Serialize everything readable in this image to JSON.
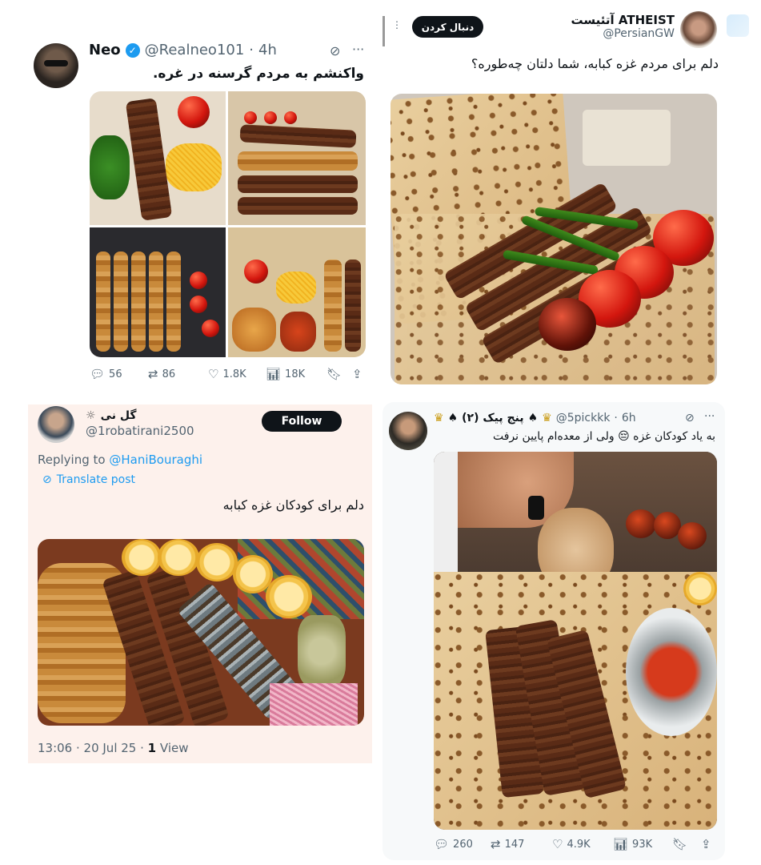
{
  "posts": {
    "neo": {
      "name": "Neo",
      "handle": "@Realneo101",
      "time": "4h",
      "text": "واکنشم به مردم گرسنه در غره.",
      "metrics": {
        "replies": "56",
        "reposts": "86",
        "likes": "1.8K",
        "views": "18K"
      }
    },
    "atheist": {
      "name": "ATHEIST آتئیست",
      "handle": "@PersianGW",
      "follow_label": "دنبال کردن",
      "text": "دلم برای مردم غزه کبابه، شما دلتان چه‌طوره؟"
    },
    "gol": {
      "name": "گل نی",
      "handle": "@1robatirani2500",
      "follow_label": "Follow",
      "replying_prefix": "Replying to",
      "replying_handle": "@HaniBouraghi",
      "translate_label": "Translate post",
      "text": "دلم برای کودکان غزه کبابه",
      "footer_time": "13:06 · 20 Jul 25 ·",
      "footer_views_count": "1",
      "footer_views_label": "View"
    },
    "panjpick": {
      "name": "پنج پیک (۲)",
      "handle": "@5pickkk",
      "time": "6h",
      "text": "به یاد کودکان غزه 😔 ولی از معده‌ام پایین نرفت",
      "metrics": {
        "replies": "260",
        "reposts": "147",
        "likes": "4.9K",
        "views": "93K"
      }
    }
  },
  "colors": {
    "verified": "#1d9bf0",
    "link": "#1d9bf0",
    "follow_bg": "#0f1419",
    "pink_card_bg": "#fdf1ec",
    "muted": "#536471"
  },
  "icons": [
    "verified-icon",
    "grok-icon",
    "more-icon",
    "reply-icon",
    "repost-icon",
    "like-icon",
    "views-icon",
    "bookmark-icon",
    "share-icon",
    "translate-icon",
    "crown-icon",
    "spade-icon"
  ]
}
